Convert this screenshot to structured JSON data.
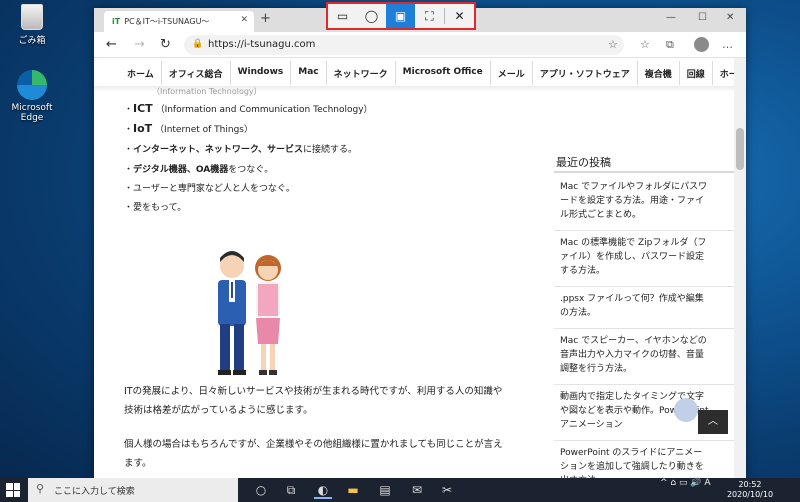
{
  "desktop": {
    "recycle_label": "ごみ箱",
    "edge_label": "Microsoft Edge"
  },
  "snip_toolbar": {
    "buttons": [
      {
        "name": "rectangular-snip",
        "glyph": "▭",
        "active": false
      },
      {
        "name": "freeform-snip",
        "glyph": "◯",
        "active": false
      },
      {
        "name": "window-snip",
        "glyph": "▣",
        "active": true
      },
      {
        "name": "fullscreen-snip",
        "glyph": "⛶",
        "active": false
      },
      {
        "name": "close",
        "glyph": "✕",
        "active": false
      }
    ],
    "highlight_color": "#e0282a",
    "active_color": "#1e7fd8"
  },
  "browser": {
    "tab_title": "PC＆IT〜i-TSUNAGU〜",
    "tab_favicon": "iT",
    "url": "https://i-tsunagu.com",
    "controls": {
      "minimize": "—",
      "maximize": "☐",
      "close": "✕",
      "new_tab": "+"
    },
    "nav": {
      "back": "←",
      "forward": "→",
      "refresh": "↻"
    },
    "toolbar_icons": {
      "favorite": "☆",
      "favorites": "☆",
      "collections": "⧉"
    }
  },
  "menu": [
    "ホーム",
    "オフィス総合",
    "Windows",
    "Mac",
    "ネットワーク",
    "Microsoft Office",
    "メール",
    "アプリ・ソフトウェア",
    "複合機",
    "回線",
    "ホーム"
  ],
  "content": {
    "partial_top": "（Information Technology）",
    "bullets": [
      {
        "bold": "ICT",
        "rest": "（Information and Communication Technology）"
      },
      {
        "bold": "IoT",
        "rest": "（Internet of Things）"
      },
      {
        "bold": "インターネット、ネットワーク、サービス",
        "rest": "に接続する。"
      },
      {
        "bold": "デジタル機器、OA機器",
        "rest": "をつなぐ。"
      },
      {
        "bold": "",
        "rest": "ユーザーと専門家など人と人をつなぐ。"
      },
      {
        "bold": "",
        "rest": "愛をもって。"
      }
    ],
    "bullet_mark": "・",
    "para1": "ITの発展により、日々新しいサービスや技術が生まれる時代ですが、利用する人の知識や技術は格差が広がっているように感じます。",
    "para2": "個人様の場合はもちろんですが、企業様やその他組織様に置かれましても同じことが言えます。"
  },
  "sidebar": {
    "title": "最近の投稿",
    "posts": [
      "Mac でファイルやフォルダにパスワードを設定する方法。用途・ファイル形式ごとまとめ。",
      "Mac の標準機能で Zipフォルダ（ファイル）を作成し、パスワード設定する方法。",
      ".ppsx ファイルって何？作成や編集の方法。",
      "Mac でスピーカー、イヤホンなどの音声出力や入力マイクの切替、音量調整を行う方法。",
      "動画内で指定したタイミングで文字や図などを表示や動作。PowerPoint アニメーション",
      "PowerPoint のスライドにアニメーションを追加して強調したり動きを出す方法"
    ],
    "back_to_top": "︿"
  },
  "taskbar": {
    "search_placeholder": "ここに入力して検索",
    "time": "20:52",
    "date": "2020/10/10",
    "tray": "^ ⌂ ▭ 🔊 A"
  }
}
